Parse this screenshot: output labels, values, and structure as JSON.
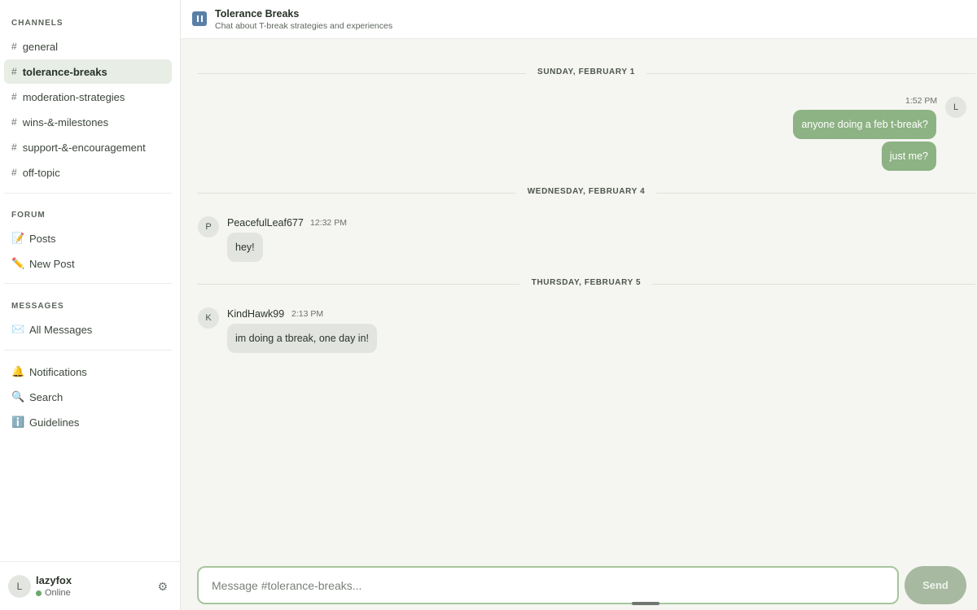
{
  "sidebar": {
    "channels_title": "CHANNELS",
    "channels": [
      {
        "label": "general"
      },
      {
        "label": "tolerance-breaks",
        "active": true
      },
      {
        "label": "moderation-strategies"
      },
      {
        "label": "wins-&-milestones"
      },
      {
        "label": "support-&-encouragement"
      },
      {
        "label": "off-topic"
      }
    ],
    "hash": "#",
    "forum_title": "FORUM",
    "forum": [
      {
        "label": "Posts",
        "icon": "memo-icon"
      },
      {
        "label": "New Post",
        "icon": "pencil-icon"
      }
    ],
    "messages_title": "MESSAGES",
    "messages": [
      {
        "label": "All Messages",
        "icon": "envelope-icon"
      }
    ],
    "extras": [
      {
        "label": "Notifications",
        "icon": "bell-icon"
      },
      {
        "label": "Search",
        "icon": "magnifier-icon"
      },
      {
        "label": "Guidelines",
        "icon": "info-icon"
      }
    ]
  },
  "user": {
    "initial": "L",
    "name": "lazyfox",
    "status": "Online"
  },
  "header": {
    "title": "Tolerance Breaks",
    "subtitle": "Chat about T-break strategies and experiences"
  },
  "conversation": {
    "day1": {
      "label": "SUNDAY, FEBRUARY 1",
      "time": "1:52 PM",
      "avatar": "L",
      "msg1": "anyone doing a feb t-break?",
      "msg2": "just me?"
    },
    "day2": {
      "label": "WEDNESDAY, FEBRUARY 4",
      "avatar": "P",
      "author": "PeacefulLeaf677",
      "time": "12:32 PM",
      "msg": "hey!"
    },
    "day3": {
      "label": "THURSDAY, FEBRUARY 5",
      "avatar": "K",
      "author": "KindHawk99",
      "time": "2:13 PM",
      "msg": "im doing a tbreak, one day in!"
    }
  },
  "composer": {
    "placeholder": "Message #tolerance-breaks...",
    "send_label": "Send"
  },
  "colors": {
    "accent": "#8db283",
    "active_bg": "#e8ede5",
    "online": "#6aa86a"
  }
}
